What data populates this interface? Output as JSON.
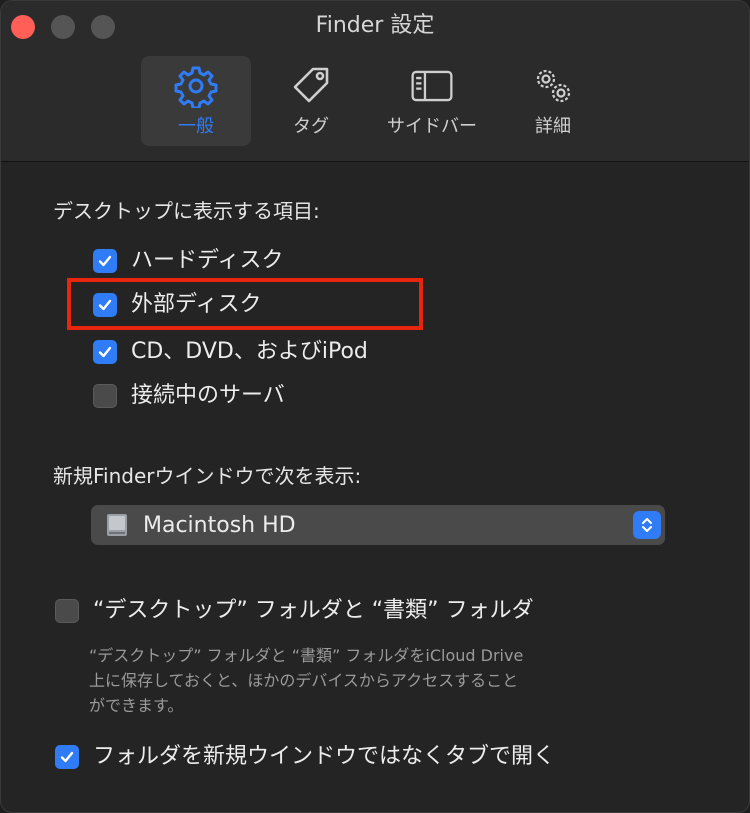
{
  "window": {
    "title": "Finder 設定"
  },
  "tabs": [
    {
      "label": "一般",
      "icon": "gear-icon",
      "active": true
    },
    {
      "label": "タグ",
      "icon": "tag-icon",
      "active": false
    },
    {
      "label": "サイドバー",
      "icon": "sidebar-icon",
      "active": false
    },
    {
      "label": "詳細",
      "icon": "gears-icon",
      "active": false
    }
  ],
  "desktop_section": {
    "title": "デスクトップに表示する項目:",
    "items": [
      {
        "label": "ハードディスク",
        "checked": true
      },
      {
        "label": "外部ディスク",
        "checked": true,
        "highlighted": true
      },
      {
        "label": "CD、DVD、およびiPod",
        "checked": true
      },
      {
        "label": "接続中のサーバ",
        "checked": false
      }
    ]
  },
  "new_window_section": {
    "title": "新規Finderウインドウで次を表示:",
    "selected": "Macintosh HD",
    "icon": "hard-disk-icon"
  },
  "icloud_option": {
    "label": "“デスクトップ” フォルダと “書類” フォルダ",
    "checked": false,
    "description_lines": [
      "“デスクトップ” フォルダと “書類” フォルダをiCloud Drive",
      "上に保存しておくと、ほかのデバイスからアクセスすること",
      "ができます。"
    ]
  },
  "tabs_option": {
    "label": "フォルダを新規ウインドウではなくタブで開く",
    "checked": true
  },
  "colors": {
    "accent": "#2f7cf6",
    "highlight": "#e8260e",
    "close": "#ff5f57"
  }
}
